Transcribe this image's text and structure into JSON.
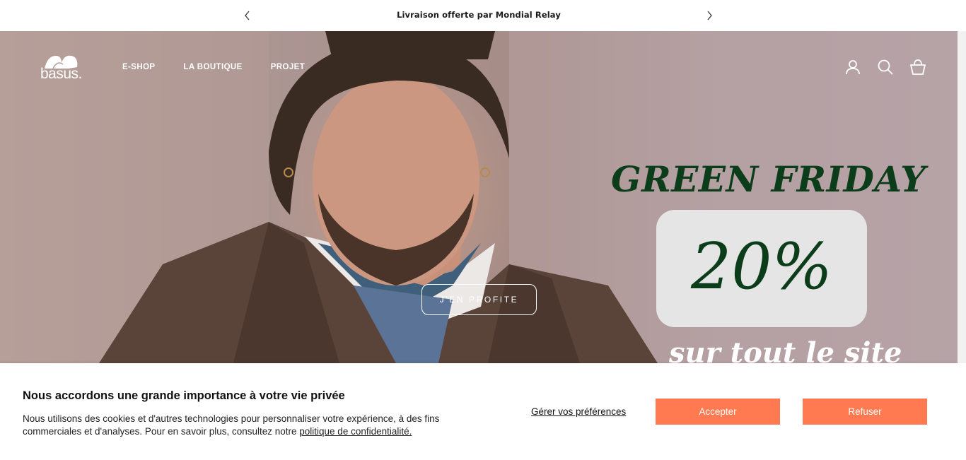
{
  "announcement": {
    "message": "Livraison offerte par Mondial Relay",
    "prev_icon": "chevron-left-icon",
    "next_icon": "chevron-right-icon"
  },
  "header": {
    "logo_text": "basus.",
    "nav": [
      "E-SHOP",
      "LA BOUTIQUE",
      "PROJET"
    ],
    "icons": [
      "account-icon",
      "search-icon",
      "cart-icon"
    ]
  },
  "hero": {
    "promo_title": "GREEN FRIDAY",
    "promo_discount": "20%",
    "promo_subtitle": "sur tout le site",
    "cta_label": "J'EN PROFITE",
    "accent_color": "#0b3d1b"
  },
  "cookie": {
    "title": "Nous accordons une grande importance à votre vie privée",
    "body_text": "Nous utilisons des cookies et d'autres technologies pour personnaliser votre expérience, à des fins commerciales et d'analyses. Pour en savoir plus, consultez notre ",
    "policy_link": "politique de confidentialité.",
    "manage_label": "Gérer vos préférences",
    "accept_label": "Accepter",
    "refuse_label": "Refuser",
    "button_color": "#ff7a50"
  }
}
